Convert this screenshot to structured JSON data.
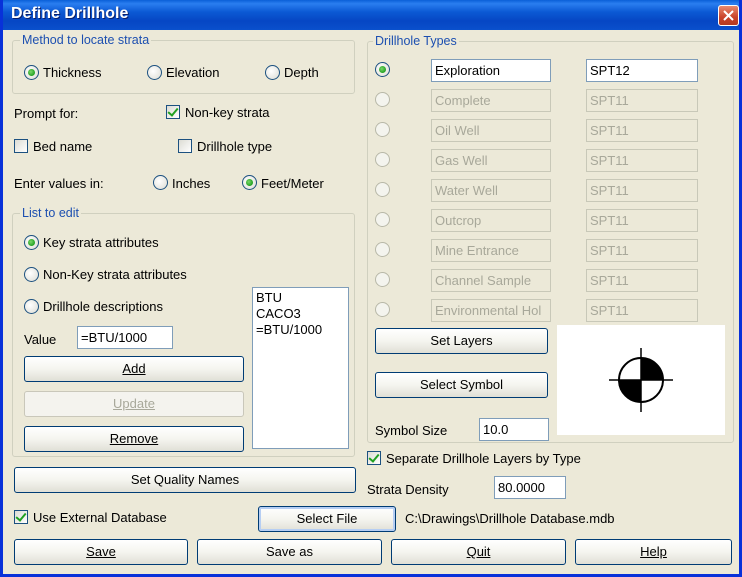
{
  "window": {
    "title": "Define Drillhole"
  },
  "method": {
    "title": "Method to locate strata",
    "options": [
      "Thickness",
      "Elevation",
      "Depth"
    ],
    "selected": "Thickness"
  },
  "prompt": {
    "label": "Prompt for:",
    "nonkey_strata": {
      "label": "Non-key strata",
      "checked": true
    },
    "bed_name": {
      "label": "Bed name",
      "checked": false
    },
    "drillhole_type": {
      "label": "Drillhole type",
      "checked": false
    }
  },
  "units": {
    "label": "Enter values in:",
    "options": [
      "Inches",
      "Feet/Meter"
    ],
    "selected": "Feet/Meter"
  },
  "list_to_edit": {
    "title": "List to edit",
    "options": [
      "Key strata attributes",
      "Non-Key strata attributes",
      "Drillhole descriptions"
    ],
    "selected": "Key strata attributes",
    "value_label": "Value",
    "value": "=BTU/1000",
    "items": [
      "BTU",
      "CACO3",
      "=BTU/1000"
    ],
    "add": "Add",
    "update": "Update",
    "remove": "Remove"
  },
  "buttons": {
    "set_quality_names": "Set Quality Names",
    "use_external_db": "Use External Database",
    "use_external_db_checked": true,
    "select_file": "Select File",
    "file_path": "C:\\Drawings\\Drillhole Database.mdb",
    "save": "Save",
    "save_as": "Save as",
    "quit": "Quit",
    "help": "Help"
  },
  "drillhole_types": {
    "title": "Drillhole Types",
    "rows": [
      {
        "name": "Exploration",
        "symbol": "SPT12",
        "enabled": true,
        "selected": true
      },
      {
        "name": "Complete",
        "symbol": "SPT11",
        "enabled": false,
        "selected": false
      },
      {
        "name": "Oil Well",
        "symbol": "SPT11",
        "enabled": false,
        "selected": false
      },
      {
        "name": "Gas Well",
        "symbol": "SPT11",
        "enabled": false,
        "selected": false
      },
      {
        "name": "Water Well",
        "symbol": "SPT11",
        "enabled": false,
        "selected": false
      },
      {
        "name": "Outcrop",
        "symbol": "SPT11",
        "enabled": false,
        "selected": false
      },
      {
        "name": "Mine Entrance",
        "symbol": "SPT11",
        "enabled": false,
        "selected": false
      },
      {
        "name": "Channel Sample",
        "symbol": "SPT11",
        "enabled": false,
        "selected": false
      },
      {
        "name": "Environmental Hol",
        "symbol": "SPT11",
        "enabled": false,
        "selected": false
      }
    ],
    "set_layers": "Set Layers",
    "select_symbol": "Select Symbol",
    "symbol_size_label": "Symbol Size",
    "symbol_size": "10.0"
  },
  "separate_layers": {
    "label": "Separate Drillhole Layers by Type",
    "checked": true
  },
  "strata_density": {
    "label": "Strata Density",
    "value": "80.0000"
  },
  "icons": {
    "close": "close-icon",
    "symbol": "drillhole-symbol-icon"
  }
}
